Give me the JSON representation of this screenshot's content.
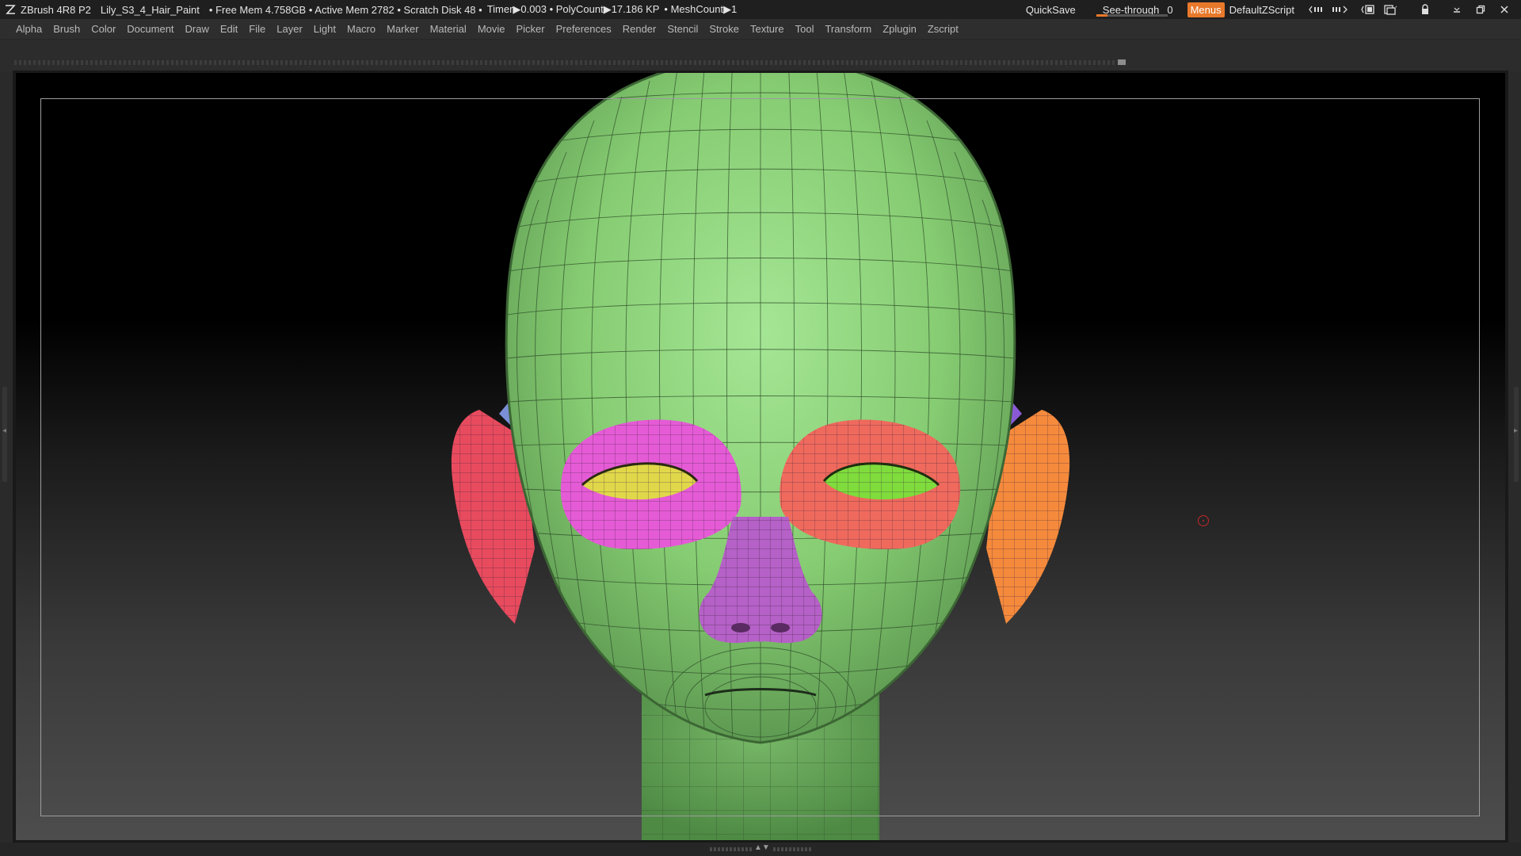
{
  "titlebar": {
    "app": "ZBrush 4R8 P2",
    "document": "Lily_S3_4_Hair_Paint",
    "stats": "• Free Mem 4.758GB • Active Mem 2782 • Scratch Disk 48 •",
    "timer": "Timer▶0.003 • PolyCount▶17.186 KP",
    "meshcount": "• MeshCount▶1",
    "quicksave": "QuickSave",
    "see_through_label": "See-through",
    "see_through_value": "0",
    "see_through_level": 0.15,
    "menus_label": "Menus",
    "zscript_label": "DefaultZScript",
    "accent_color": "#e8792b"
  },
  "menubar": {
    "items": [
      "Alpha",
      "Brush",
      "Color",
      "Document",
      "Draw",
      "Edit",
      "File",
      "Layer",
      "Light",
      "Macro",
      "Marker",
      "Material",
      "Movie",
      "Picker",
      "Preferences",
      "Render",
      "Stencil",
      "Stroke",
      "Texture",
      "Tool",
      "Transform",
      "Zplugin",
      "Zscript"
    ]
  },
  "viewport": {
    "model": "polygroup head mesh",
    "polygroup_colors": {
      "face": "#7fcb6e",
      "left_eye_socket": "#e55bd6",
      "left_eyeball": "#e0d84a",
      "right_eye_socket": "#ef6a5d",
      "right_eyeball": "#7fdc3c",
      "nose": "#b561c7",
      "left_ear": "#e84b5e",
      "right_ear": "#f58a3c",
      "ear_inner_left": "#7b8fd6",
      "ear_inner_right": "#8a5ad6"
    }
  }
}
